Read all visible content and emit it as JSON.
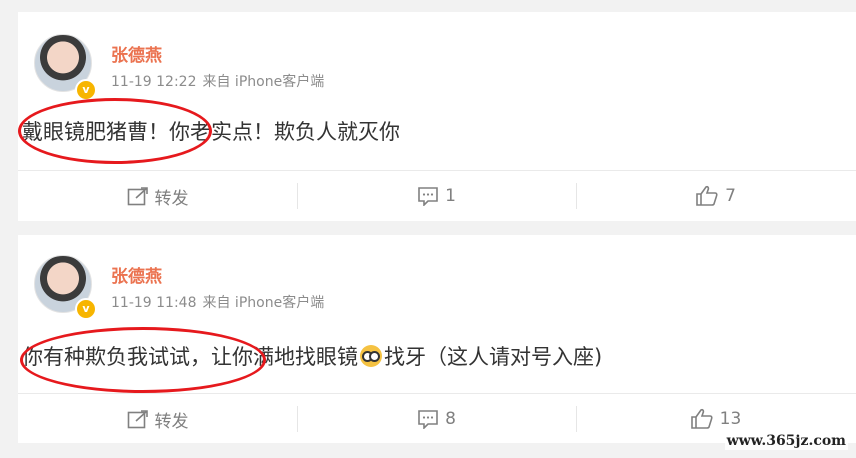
{
  "posts": [
    {
      "username": "张德燕",
      "time": "11-19 12:22",
      "source": "来自 iPhone客户端",
      "content_before": "戴眼镜肥猪曹！你老实点！欺负人就灭你",
      "content_after": "",
      "has_emoji": false,
      "repost_label": "转发",
      "comment_count": "1",
      "like_count": "7"
    },
    {
      "username": "张德燕",
      "time": "11-19 11:48",
      "source": "来自 iPhone客户端",
      "content_before": "你有种欺负我试试，让你满地找眼镜",
      "content_after": "找牙（这人请对号入座)",
      "has_emoji": true,
      "repost_label": "转发",
      "comment_count": "8",
      "like_count": "13"
    }
  ],
  "watermark": "www.365jz.com",
  "colors": {
    "username": "#eb7350",
    "annotation_circle": "#e6191d",
    "verified_badge": "#f7b500"
  },
  "icons": {
    "repost": "repost-icon",
    "comment": "comment-icon",
    "like": "like-icon",
    "verified": "verified-badge-icon",
    "emoji": "glasses-emoji-icon"
  }
}
